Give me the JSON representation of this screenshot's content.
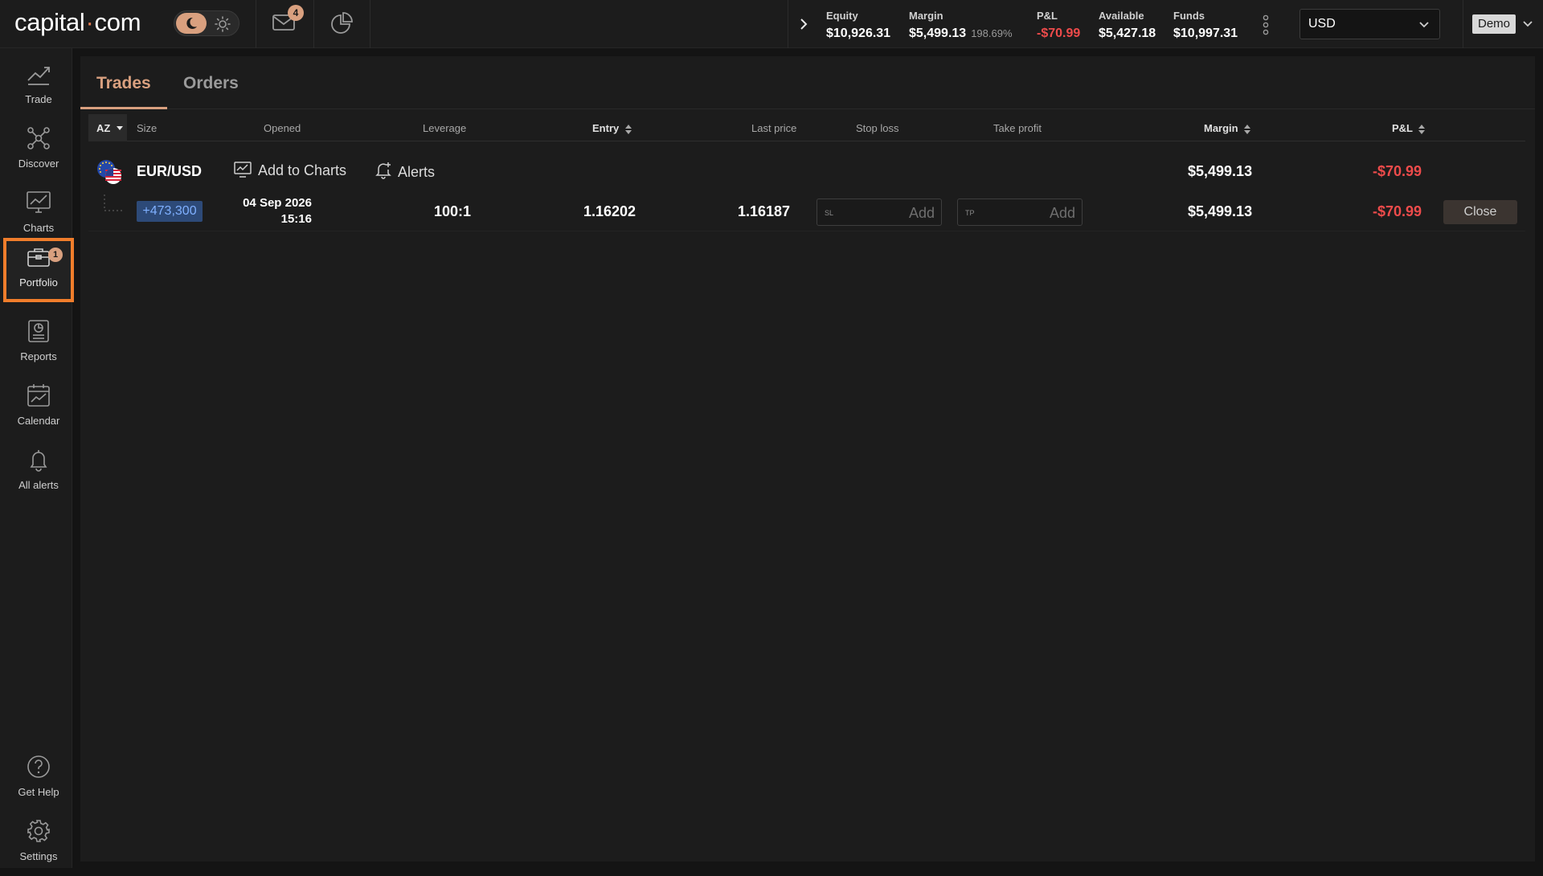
{
  "app": {
    "logo_left": "capital",
    "logo_dot": "·",
    "logo_right": "com"
  },
  "header": {
    "mail_badge": "4",
    "stats": [
      {
        "label": "Equity",
        "value": "$10,926.31"
      },
      {
        "label": "Margin",
        "value": "$5,499.13",
        "extra": "198.69%"
      },
      {
        "label": "P&L",
        "value": "-$70.99"
      },
      {
        "label": "Available",
        "value": "$5,427.18"
      },
      {
        "label": "Funds",
        "value": "$10,997.31"
      }
    ],
    "currency": "USD",
    "account_mode": "Demo"
  },
  "sidebar": {
    "items": [
      {
        "label": "Trade",
        "icon": "trade-icon"
      },
      {
        "label": "Discover",
        "icon": "discover-icon"
      },
      {
        "label": "Charts",
        "icon": "charts-icon"
      },
      {
        "label": "Portfolio",
        "icon": "portfolio-icon",
        "badge": "1",
        "active": true
      },
      {
        "label": "Reports",
        "icon": "reports-icon"
      },
      {
        "label": "Calendar",
        "icon": "calendar-icon"
      },
      {
        "label": "All alerts",
        "icon": "bell-icon"
      }
    ],
    "bottom": [
      {
        "label": "Get Help",
        "icon": "help-icon"
      },
      {
        "label": "Settings",
        "icon": "gear-icon"
      }
    ]
  },
  "tabs": [
    {
      "label": "Trades",
      "active": true
    },
    {
      "label": "Orders"
    }
  ],
  "table": {
    "columns": {
      "az": "AZ",
      "size": "Size",
      "opened": "Opened",
      "leverage": "Leverage",
      "entry": "Entry",
      "last_price": "Last price",
      "stop_loss": "Stop loss",
      "take_profit": "Take profit",
      "margin": "Margin",
      "pnl": "P&L"
    },
    "market_row": {
      "pair": "EUR/USD",
      "add_to_charts": "Add to Charts",
      "alerts": "Alerts",
      "margin": "$5,499.13",
      "pnl": "-$70.99"
    },
    "trade_row": {
      "size": "+473,300",
      "opened_date": "04 Sep 2026",
      "opened_time": "15:16",
      "leverage": "100:1",
      "entry": "1.16202",
      "last_price": "1.16187",
      "sl_placeholder": "SL",
      "sl_add": "Add",
      "tp_placeholder": "TP",
      "tp_add": "Add",
      "margin": "$5,499.13",
      "pnl": "-$70.99",
      "close_label": "Close"
    }
  },
  "colors": {
    "accent": "#d9a07f",
    "active_outline": "#f07d2b",
    "negative": "#ee4b4b",
    "size_pill": "#2d4a78"
  }
}
